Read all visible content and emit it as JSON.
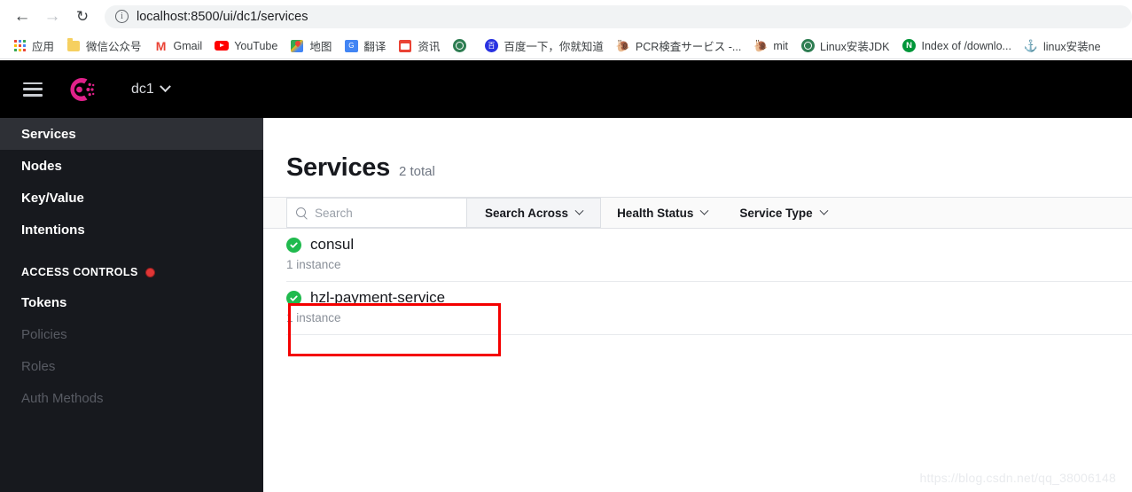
{
  "browser": {
    "back_icon": "back-arrow-icon",
    "forward_icon": "forward-arrow-icon",
    "reload_icon": "reload-icon",
    "info_glyph": "i",
    "url": "localhost:8500/ui/dc1/services",
    "bookmarks": [
      {
        "label": "应用",
        "icon": "apps-grid-icon"
      },
      {
        "label": "微信公众号",
        "icon": "folder-icon"
      },
      {
        "label": "Gmail",
        "icon": "gmail-icon"
      },
      {
        "label": "YouTube",
        "icon": "youtube-icon"
      },
      {
        "label": "地图",
        "icon": "google-maps-icon"
      },
      {
        "label": "翻译",
        "icon": "google-translate-icon"
      },
      {
        "label": "资讯",
        "icon": "google-news-icon"
      },
      {
        "label": "",
        "icon": "globe-icon"
      },
      {
        "label": "百度一下，你就知道",
        "icon": "baidu-icon"
      },
      {
        "label": "PCR検査サービス -...",
        "icon": "bat-icon"
      },
      {
        "label": "mit",
        "icon": "bat-icon"
      },
      {
        "label": "Linux安装JDK",
        "icon": "globe-icon"
      },
      {
        "label": "Index of /downlo...",
        "icon": "nginx-icon"
      },
      {
        "label": "linux安装ne",
        "icon": "anchor-icon"
      }
    ]
  },
  "app_header": {
    "menu_icon": "hamburger-menu-icon",
    "logo_icon": "consul-logo-icon",
    "datacenter": "dc1",
    "datacenter_chevron": "chevron-down-icon"
  },
  "sidebar": {
    "items": [
      {
        "label": "Services",
        "state": "active"
      },
      {
        "label": "Nodes",
        "state": "normal"
      },
      {
        "label": "Key/Value",
        "state": "normal"
      },
      {
        "label": "Intentions",
        "state": "normal"
      }
    ],
    "section": {
      "label": "ACCESS CONTROLS",
      "badge_icon": "red-dot-icon"
    },
    "acl_items": [
      {
        "label": "Tokens",
        "state": "normal"
      },
      {
        "label": "Policies",
        "state": "dim"
      },
      {
        "label": "Roles",
        "state": "dim"
      },
      {
        "label": "Auth Methods",
        "state": "dim"
      }
    ]
  },
  "main": {
    "title": "Services",
    "total": "2 total",
    "search": {
      "placeholder": "Search",
      "value": "",
      "icon": "search-icon"
    },
    "filters": [
      {
        "label": "Search Across",
        "chevron": "chevron-down-icon",
        "boxed": true
      },
      {
        "label": "Health Status",
        "chevron": "chevron-down-icon",
        "boxed": false
      },
      {
        "label": "Service Type",
        "chevron": "chevron-down-icon",
        "boxed": false
      }
    ],
    "services": [
      {
        "name": "consul",
        "instances": "1 instance",
        "health_icon": "health-passing-icon",
        "highlighted": false
      },
      {
        "name": "hzl-payment-service",
        "instances": "1 instance",
        "health_icon": "health-passing-icon",
        "highlighted": true
      }
    ]
  },
  "watermark": "https://blog.csdn.net/qq_38006148",
  "colors": {
    "brand_pink": "#e0218a",
    "sidebar_bg": "#17191e",
    "sidebar_active": "#2e3036",
    "health_green": "#20ba4e",
    "highlight_red": "#f40000",
    "alert_red": "#e03636"
  }
}
